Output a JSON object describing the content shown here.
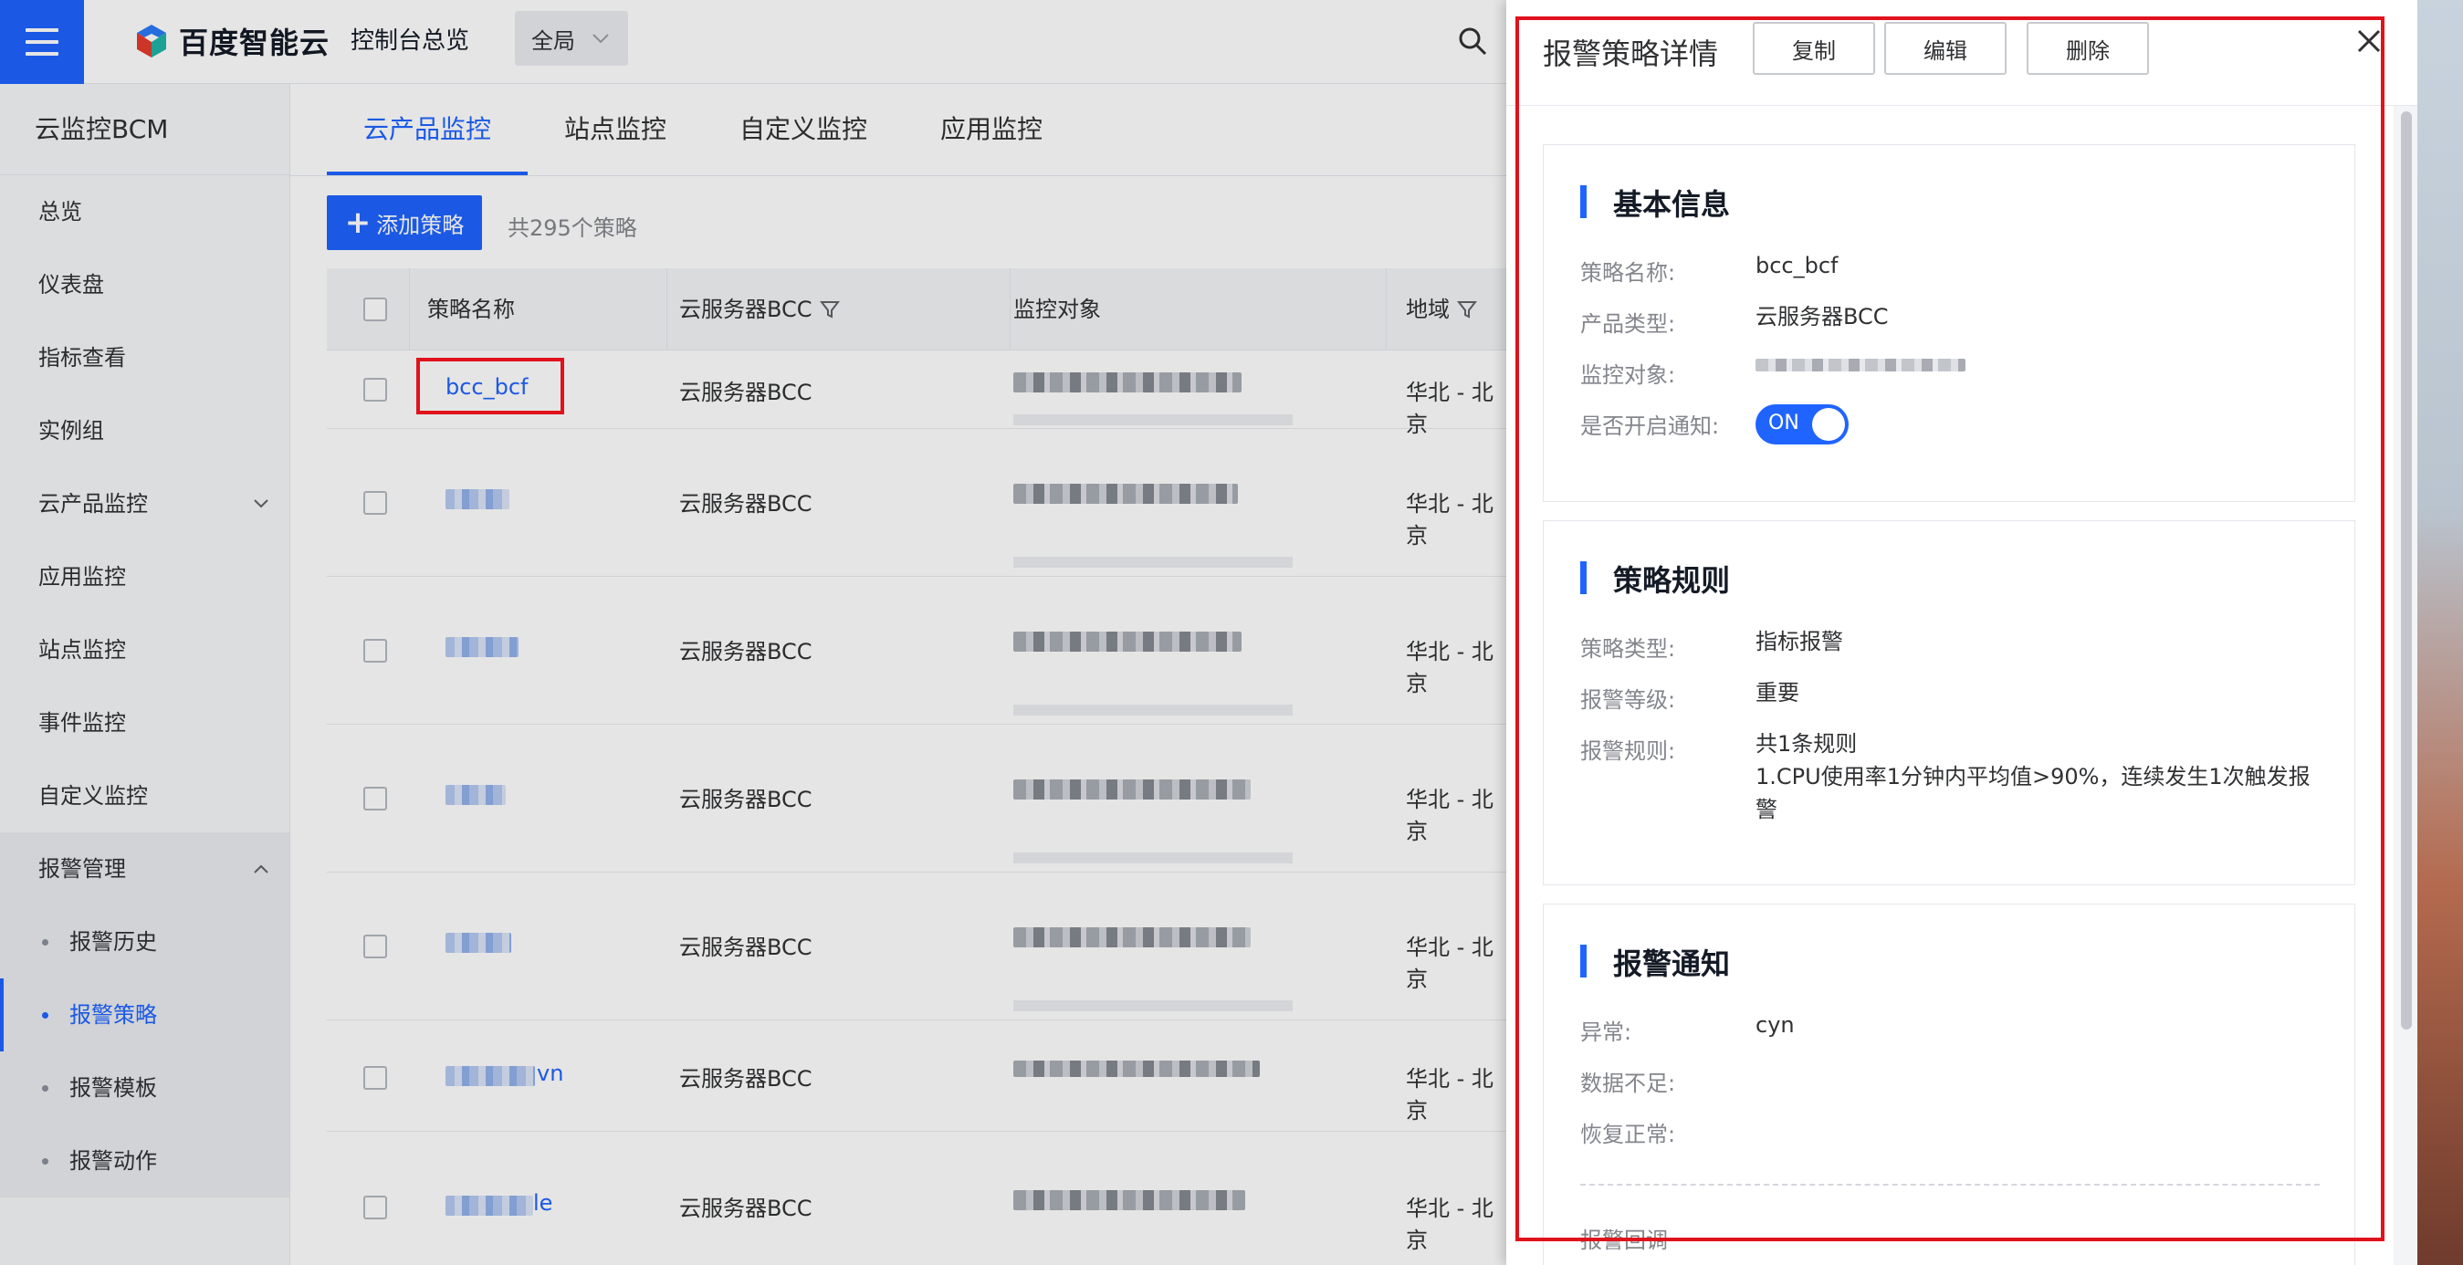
{
  "topbar": {
    "logo_text": "百度智能云",
    "console_home": "控制台总览",
    "region": "全局"
  },
  "sidebar": {
    "title": "云监控BCM",
    "items": [
      {
        "label": "总览"
      },
      {
        "label": "仪表盘"
      },
      {
        "label": "指标查看"
      },
      {
        "label": "实例组"
      },
      {
        "label": "云产品监控"
      },
      {
        "label": "应用监控"
      },
      {
        "label": "站点监控"
      },
      {
        "label": "事件监控"
      },
      {
        "label": "自定义监控"
      },
      {
        "label": "报警管理"
      }
    ],
    "alarm_sub": [
      {
        "label": "报警历史"
      },
      {
        "label": "报警策略"
      },
      {
        "label": "报警模板"
      },
      {
        "label": "报警动作"
      }
    ]
  },
  "main": {
    "tabs": [
      {
        "label": "云产品监控"
      },
      {
        "label": "站点监控"
      },
      {
        "label": "自定义监控"
      },
      {
        "label": "应用监控"
      }
    ],
    "add_button": "添加策略",
    "count": "共295个策略",
    "columns": [
      "策略名称",
      "云服务器BCC",
      "监控对象",
      "地域"
    ],
    "rows": [
      {
        "name": "bcc_bcf",
        "product": "云服务器BCC",
        "region": "华北 - 北京"
      },
      {
        "name": "",
        "product": "云服务器BCC",
        "region": "华北 - 北京"
      },
      {
        "name": "",
        "product": "云服务器BCC",
        "region": "华北 - 北京"
      },
      {
        "name": "",
        "product": "云服务器BCC",
        "region": "华北 - 北京"
      },
      {
        "name": "",
        "product": "云服务器BCC",
        "region": "华北 - 北京"
      },
      {
        "name": "vn",
        "product": "云服务器BCC",
        "region": "华北 - 北京"
      },
      {
        "name": "le",
        "product": "云服务器BCC",
        "region": "华北 - 北京"
      }
    ]
  },
  "drawer": {
    "title": "报警策略详情",
    "buttons": {
      "copy": "复制",
      "edit": "编辑",
      "delete": "删除"
    },
    "basic": {
      "title": "基本信息",
      "name_label": "策略名称:",
      "name_value": "bcc_bcf",
      "type_label": "产品类型:",
      "type_value": "云服务器BCC",
      "target_label": "监控对象:",
      "notify_label": "是否开启通知:",
      "toggle_text": "ON"
    },
    "rules": {
      "title": "策略规则",
      "kind_label": "策略类型:",
      "kind_value": "指标报警",
      "level_label": "报警等级:",
      "level_value": "重要",
      "rule_label": "报警规则:",
      "rule_count": "共1条规则",
      "rule_detail": "1.CPU使用率1分钟内平均值>90%，连续发生1次触发报警"
    },
    "notify": {
      "title": "报警通知",
      "abnormal_label": "异常:",
      "abnormal_value": "cyn",
      "insufficient_label": "数据不足:",
      "recover_label": "恢复正常:",
      "callback_label": "报警回调"
    }
  },
  "colors": {
    "accent": "#1f64ff",
    "highlight": "#e0121c"
  }
}
